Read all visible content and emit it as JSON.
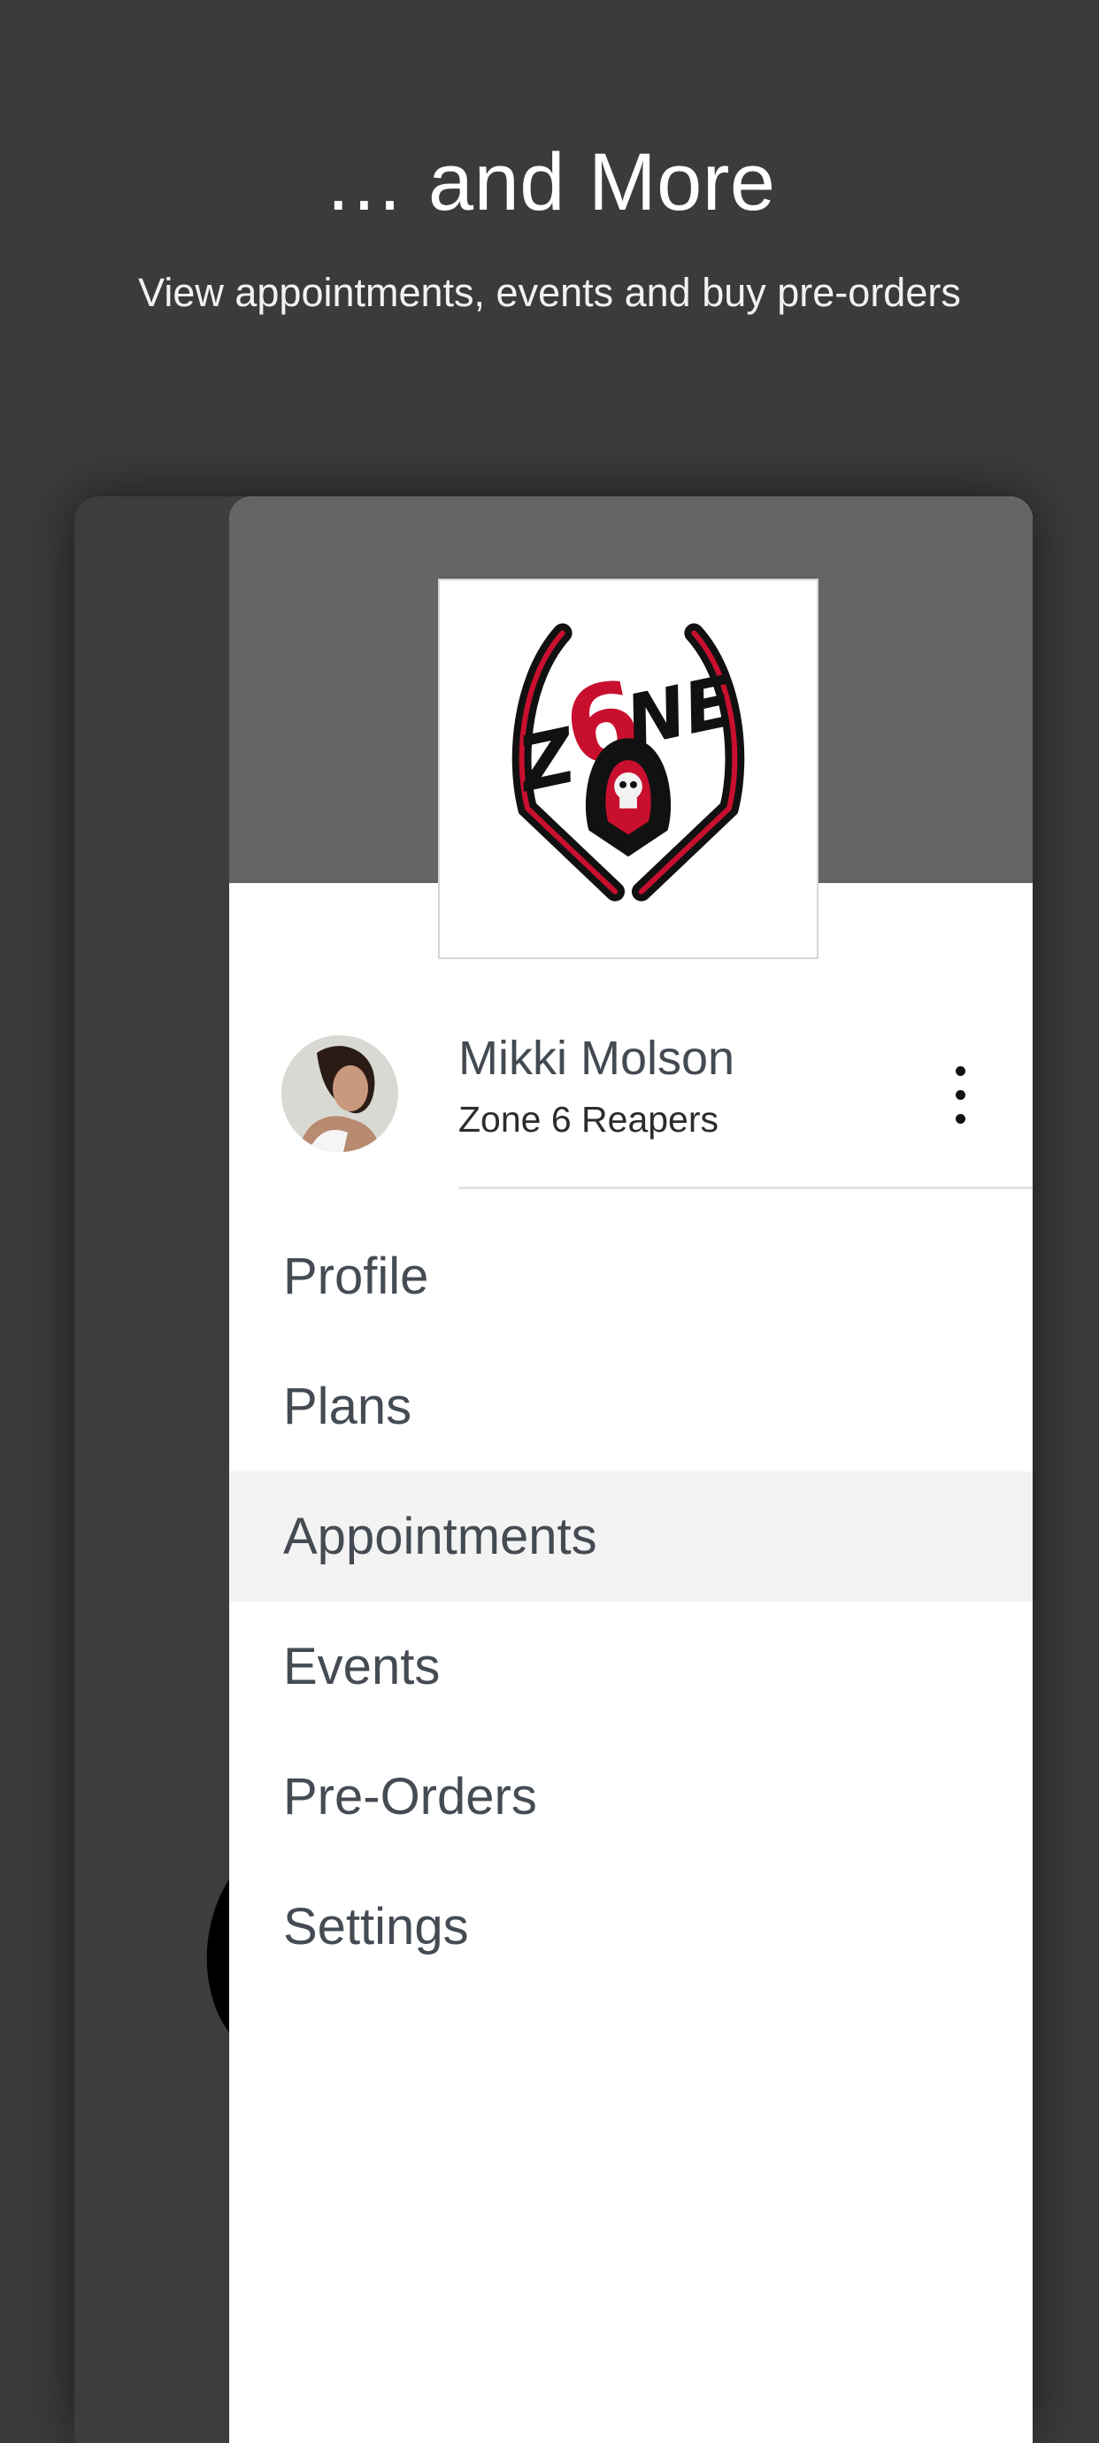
{
  "promo": {
    "headline": "… and More",
    "subheadline": "View appointments, events and buy pre-orders"
  },
  "drawer": {
    "logo_icon": "zone6-reapers-logo",
    "user": {
      "avatar_icon": "user-avatar",
      "name": "Mikki Molson",
      "team": "Zone 6 Reapers",
      "more_icon": "vertical-ellipsis-icon"
    },
    "menu": [
      {
        "label": "Profile",
        "active": false
      },
      {
        "label": "Plans",
        "active": false
      },
      {
        "label": "Appointments",
        "active": true
      },
      {
        "label": "Events",
        "active": false
      },
      {
        "label": "Pre-Orders",
        "active": false
      },
      {
        "label": "Settings",
        "active": false
      }
    ]
  },
  "colors": {
    "background": "#3b3b3b",
    "drawer_header": "#646464",
    "active_row": "#f3f3f3",
    "menu_text": "#454b53",
    "logo_red": "#c8102e"
  }
}
